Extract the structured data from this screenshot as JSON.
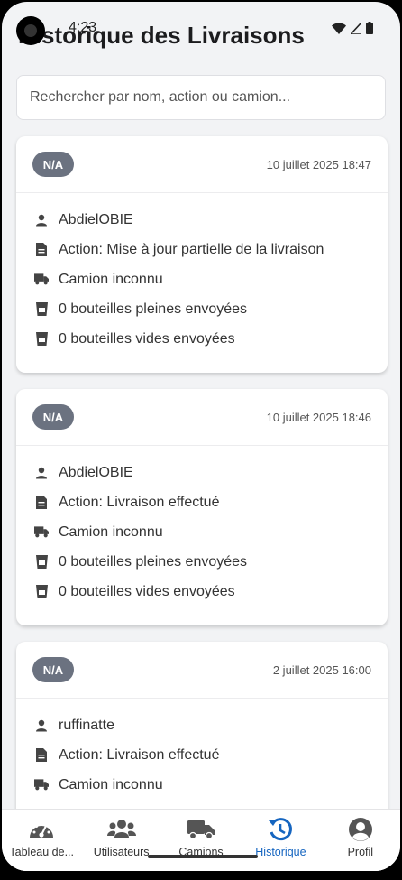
{
  "status_bar": {
    "time": "4:23"
  },
  "header": {
    "title": "Historique des Livraisons"
  },
  "search": {
    "placeholder": "Rechercher par nom, action ou camion..."
  },
  "deliveries": [
    {
      "badge": "N/A",
      "date": "10 juillet 2025 18:47",
      "user": "AbdielOBIE",
      "action": "Action: Mise à jour partielle de la livraison",
      "truck": "Camion inconnu",
      "full_bottles": "0 bouteilles pleines envoyées",
      "empty_bottles": "0 bouteilles vides envoyées"
    },
    {
      "badge": "N/A",
      "date": "10 juillet 2025 18:46",
      "user": "AbdielOBIE",
      "action": "Action: Livraison effectué",
      "truck": "Camion inconnu",
      "full_bottles": "0 bouteilles pleines envoyées",
      "empty_bottles": "0 bouteilles vides envoyées"
    },
    {
      "badge": "N/A",
      "date": "2 juillet 2025 16:00",
      "user": "ruffinatte",
      "action": "Action: Livraison effectué",
      "truck": "Camion inconnu",
      "full_bottles": "",
      "empty_bottles": ""
    }
  ],
  "nav": {
    "items": [
      {
        "label": "Tableau de...",
        "icon": "dashboard-gauge-icon"
      },
      {
        "label": "Utilisateurs",
        "icon": "users-icon"
      },
      {
        "label": "Camions",
        "icon": "truck-icon"
      },
      {
        "label": "Historique",
        "icon": "history-icon",
        "active": true
      },
      {
        "label": "Profil",
        "icon": "profile-icon"
      }
    ]
  },
  "colors": {
    "accent": "#1565c0",
    "badge": "#6b7280",
    "background": "#f2f3f5"
  }
}
